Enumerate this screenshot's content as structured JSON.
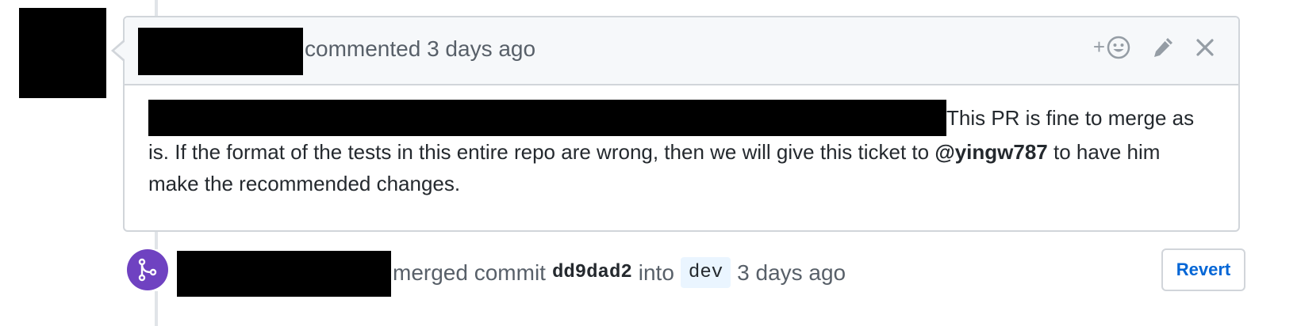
{
  "comment": {
    "header_text": "commented 3 days ago",
    "body_after_redaction_line1": "This PR is fine to merge as is. If the format of the tests in this entire repo are wrong, then we will give this ticket to",
    "mention": "@yingw787",
    "body_after_mention": " to have him make the recommended changes."
  },
  "header_icons": {
    "reaction": "add-reaction-icon",
    "edit": "pencil-icon",
    "delete": "close-icon",
    "reaction_prefix": "+"
  },
  "merge_event": {
    "icon": "git-merge-icon",
    "verb": "merged commit",
    "commit_sha": "dd9dad2",
    "preposition": "into",
    "branch": "dev",
    "time": "3 days ago",
    "revert_label": "Revert"
  },
  "colors": {
    "merge_purple": "#6f42c1",
    "link_blue": "#0366d6",
    "header_bg": "#f6f8fa",
    "border": "#d1d5da"
  }
}
